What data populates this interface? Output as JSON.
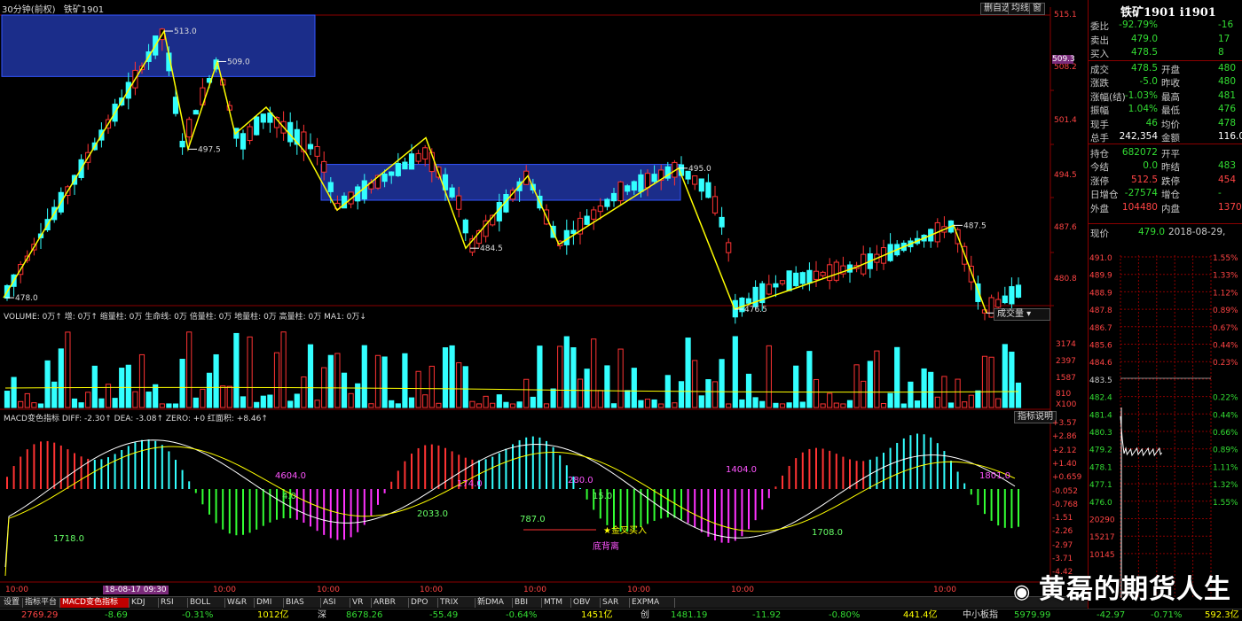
{
  "header": {
    "period": "30分钟(前权)",
    "symbol": "铁矿1901",
    "btn_redraw": "删自选",
    "btn_avg": "均线",
    "btn_other": "窗"
  },
  "price_axis": [
    "515.1",
    "508.2",
    "501.4",
    "494.5",
    "487.6",
    "480.8"
  ],
  "price_box": "509.3",
  "price_annotations": [
    "513.0",
    "509.0",
    "497.5",
    "478.0",
    "484.5",
    "495.0",
    "476.5",
    "487.5",
    "476.0"
  ],
  "volume_bar": {
    "title": "VOLUME: 0万↑ 增: 0万↑ 缩量柱: 0万 生命线: 0万 倍量柱: 0万 地量柱: 0万 高量柱: 0万 MA1: 0万↓",
    "selector": "成交量",
    "axis": [
      "3174",
      "2397",
      "1587",
      "810",
      "X100"
    ]
  },
  "macd_bar": {
    "title": "MACD变色指标 DIFF: -2.30↑ DEA: -3.08↑ ZERO: +0 红面积: +8.46↑",
    "help": "指标说明",
    "axis": [
      "+3.57",
      "+2.86",
      "+2.12",
      "+1.40",
      "+0.659",
      "-0.052",
      "-0.768",
      "-1.51",
      "-2.26",
      "-2.97",
      "-3.71",
      "-4.42"
    ],
    "area_labels": [
      "4604.0",
      "4.0",
      "1718.0",
      "2033.0",
      "174.0",
      "787.0",
      "280.0",
      "15.0",
      "1404.0",
      "1708.0",
      "1801.0"
    ],
    "golden_cross": "金叉买入",
    "divergence": "底背离"
  },
  "time_axis": [
    "10:00",
    "18-08-17 09:30",
    "10:00",
    "10:00",
    "10:00",
    "10:00",
    "10:00",
    "10:00",
    "10:00"
  ],
  "tabs": [
    "设置",
    "指标平台",
    "MACD变色指标",
    "KDJ",
    "RSI",
    "BOLL",
    "W&R",
    "DMI",
    "BIAS",
    "ASI",
    "VR",
    "ARBR",
    "DPO",
    "TRIX",
    "新DMA",
    "BBI",
    "MTM",
    "OBV",
    "SAR",
    "EXPMA"
  ],
  "quote": {
    "title": "铁矿1901 i1901",
    "rows": [
      {
        "l": "委比",
        "v": "-92.79%",
        "c": "#33dd33",
        "v2": "-16"
      },
      {
        "l": "卖出",
        "v": "479.0",
        "c": "#33dd33",
        "v2": "17"
      },
      {
        "l": "买入",
        "v": "478.5",
        "c": "#33dd33",
        "v2": "8"
      },
      {
        "l": "成交",
        "v": "478.5",
        "c": "#33dd33",
        "l2": "开盘",
        "v2": "480"
      },
      {
        "l": "涨跌",
        "v": "-5.0",
        "c": "#33dd33",
        "l2": "昨收",
        "v2": "480"
      },
      {
        "l": "涨幅(结)",
        "v": "-1.03%",
        "c": "#33dd33",
        "l2": "最高",
        "v2": "481"
      },
      {
        "l": "振幅",
        "v": "1.04%",
        "c": "#33dd33",
        "l2": "最低",
        "v2": "476"
      },
      {
        "l": "现手",
        "v": "46",
        "c": "#33dd33",
        "l2": "均价",
        "v2": "478"
      },
      {
        "l": "总手",
        "v": "242,354",
        "c": "#ffffff",
        "l2": "金额",
        "v2": "116.0"
      },
      {
        "l": "持仓",
        "v": "682072",
        "c": "#33dd33",
        "l2": "开平",
        "v2": ""
      },
      {
        "l": "今结",
        "v": "0.0",
        "c": "#33dd33",
        "l2": "昨结",
        "v2": "483"
      },
      {
        "l": "涨停",
        "v": "512.5",
        "c": "#ff4444",
        "l2": "跌停",
        "v2": "454"
      },
      {
        "l": "日增仓",
        "v": "-27574",
        "c": "#33dd33",
        "l2": "增仓",
        "v2": "-"
      },
      {
        "l": "外盘",
        "v": "104480",
        "c": "#ff4444",
        "l2": "内盘",
        "v2": "1370"
      }
    ],
    "current_label": "现价",
    "current_price": "479.0",
    "date": "2018-08-29,",
    "mini_axis_left": [
      "491.0",
      "489.9",
      "488.9",
      "487.8",
      "486.7",
      "485.6",
      "484.6",
      "483.5",
      "482.4",
      "481.4",
      "480.3",
      "479.2",
      "478.1",
      "477.1",
      "476.0",
      "20290",
      "15217",
      "10145"
    ],
    "mini_axis_right": [
      "1.55%",
      "1.33%",
      "1.12%",
      "0.89%",
      "0.67%",
      "0.44%",
      "0.23%",
      "0.22%",
      "0.44%",
      "0.66%",
      "0.89%",
      "1.11%",
      "1.32%",
      "1.55%"
    ]
  },
  "status": {
    "sh_idx": "2769.29",
    "sh_chg": "-8.69",
    "sh_pct": "-0.31%",
    "sh_amt": "1012亿",
    "sz_label": "深",
    "sz_idx": "8678.26",
    "sz_chg": "-55.49",
    "sz_pct": "-0.64%",
    "sz_amt": "1451亿",
    "cy_label": "创",
    "cy_idx": "1481.19",
    "cy_chg": "-11.92",
    "cy_pct": "-0.80%",
    "cy_amt": "441.4亿",
    "zx_label": "中小板指",
    "zx_idx": "5979.99",
    "zx_chg": "-42.97",
    "zx_pct": "-0.71%",
    "zx_amt": "592.3亿"
  },
  "watermark": "黄磊的期货人生",
  "colors": {
    "up": "#ff3333",
    "down": "#33ffff",
    "line": "#ffff00",
    "box": "#1b2d8a",
    "grid": "#8b0000"
  }
}
